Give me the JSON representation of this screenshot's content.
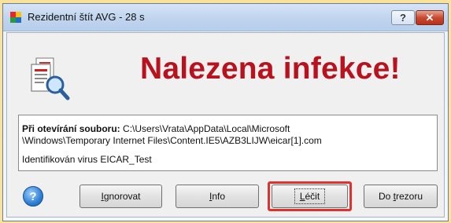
{
  "window": {
    "title": "Rezidentní štít AVG - 28 s",
    "help_btn": "?",
    "close_btn": "✕"
  },
  "headline": "Nalezena infekce!",
  "info": {
    "label": "Při otevírání souboru:",
    "path_part1": "C:\\Users\\Vrata\\AppData\\Local\\Microsoft",
    "path_part2": "\\Windows\\Temporary Internet Files\\Content.IE5\\AZB3LIJW\\eicar[1].com",
    "virus": "Identifikován virus EICAR_Test"
  },
  "buttons": {
    "help": "?",
    "ignore_prefix": "",
    "ignore_u": "I",
    "ignore_rest": "gnorovat",
    "info_u": "I",
    "info_rest": "nfo",
    "heal_u": "L",
    "heal_rest": "éčit",
    "vault_prefix": "Do ",
    "vault_u": "t",
    "vault_rest": "rezoru"
  },
  "colors": {
    "headline": "#b8121e",
    "highlight": "#e0312c",
    "page_bg": "#fbe29a"
  }
}
